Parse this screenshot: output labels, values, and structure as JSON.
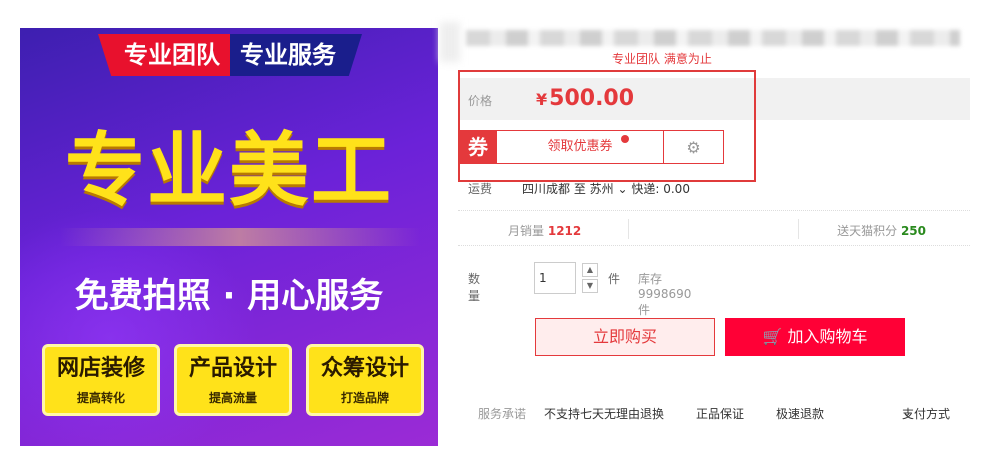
{
  "banner": {
    "tag_left": "专业团队",
    "tag_right": "专业服务",
    "title": "专业美工",
    "subtitle": "免费拍照 · 用心服务",
    "badges": [
      {
        "main": "网店装修",
        "sub": "提高转化"
      },
      {
        "main": "产品设计",
        "sub": "提高流量"
      },
      {
        "main": "众筹设计",
        "sub": "打造品牌"
      }
    ]
  },
  "product": {
    "promo_line": "专业团队 满意为止",
    "price_label": "价格",
    "currency": "¥",
    "price": "500.00",
    "coupon_tag": "券",
    "coupon_button": "领取优惠券",
    "gear_icon": "gear-icon",
    "shipping_label": "运费",
    "shipping_from": "四川成都 至 苏州",
    "shipping_express": "快递: 0.00",
    "monthly_sales_label": "月销量",
    "monthly_sales": "1212",
    "points_label": "送天猫积分",
    "points": "250",
    "quantity_label": "数量",
    "quantity_value": "1",
    "unit": "件",
    "stock": "库存9998690件",
    "buy_now": "立即购买",
    "add_to_cart": "加入购物车",
    "cart_icon": "cart-icon"
  },
  "promise": {
    "label": "服务承诺",
    "items": [
      "不支持七天无理由退换",
      "正品保证",
      "极速退款"
    ],
    "payment": "支付方式"
  },
  "colors": {
    "accent": "#e4393c",
    "cart": "#ff0036",
    "banner": "#6b22d8",
    "highlight": "#ffe21a"
  }
}
